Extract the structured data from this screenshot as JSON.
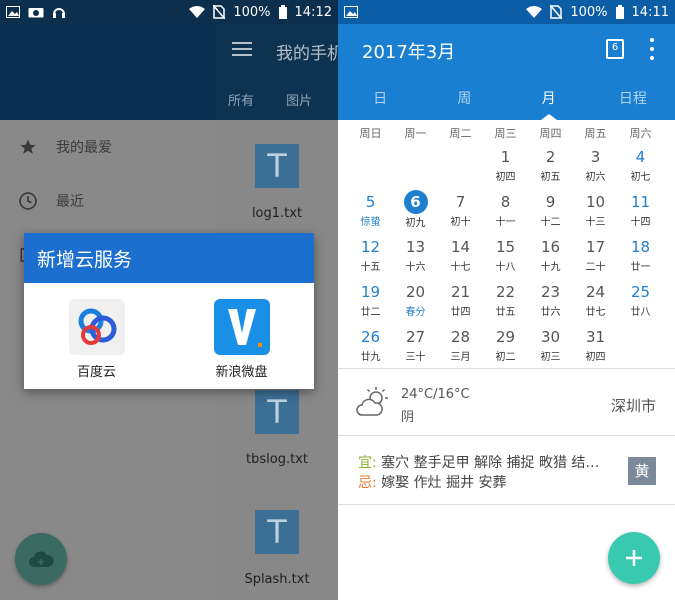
{
  "left": {
    "status": {
      "battery": "100%",
      "time": "14:12"
    },
    "drawer": {
      "items": [
        {
          "label": "我的最爱",
          "icon": "star-icon"
        },
        {
          "label": "最近",
          "icon": "clock-icon"
        }
      ]
    },
    "file_pane": {
      "title": "我的手机",
      "tabs": [
        "所有",
        "图片"
      ],
      "files": [
        {
          "name": "log1.txt",
          "icon_letter": "T"
        },
        {
          "name": "tbslog.txt",
          "icon_letter": "T"
        },
        {
          "name": "Splash.txt",
          "icon_letter": "T"
        }
      ]
    },
    "dialog": {
      "title": "新增云服务",
      "services": [
        {
          "label": "百度云",
          "icon": "baidu-cloud-icon"
        },
        {
          "label": "新浪微盘",
          "icon": "sina-vdisk-icon"
        }
      ]
    },
    "fab_icon": "cloud-add-icon"
  },
  "right": {
    "status": {
      "battery": "100%",
      "time": "14:11"
    },
    "header": {
      "title": "2017年3月",
      "today_badge": "6",
      "views": [
        "日",
        "周",
        "月",
        "日程"
      ],
      "active_view": "月"
    },
    "weekdays": [
      "周日",
      "周一",
      "周二",
      "周三",
      "周四",
      "周五",
      "周六"
    ],
    "weeks": [
      [
        null,
        null,
        null,
        {
          "d": "1",
          "l": "初四"
        },
        {
          "d": "2",
          "l": "初五"
        },
        {
          "d": "3",
          "l": "初六"
        },
        {
          "d": "4",
          "l": "初七"
        }
      ],
      [
        {
          "d": "5",
          "l": "惊蛰",
          "term": true
        },
        {
          "d": "6",
          "l": "初九",
          "today": true
        },
        {
          "d": "7",
          "l": "初十"
        },
        {
          "d": "8",
          "l": "十一"
        },
        {
          "d": "9",
          "l": "十二"
        },
        {
          "d": "10",
          "l": "十三"
        },
        {
          "d": "11",
          "l": "十四"
        }
      ],
      [
        {
          "d": "12",
          "l": "十五"
        },
        {
          "d": "13",
          "l": "十六"
        },
        {
          "d": "14",
          "l": "十七"
        },
        {
          "d": "15",
          "l": "十八"
        },
        {
          "d": "16",
          "l": "十九"
        },
        {
          "d": "17",
          "l": "二十"
        },
        {
          "d": "18",
          "l": "廿一"
        }
      ],
      [
        {
          "d": "19",
          "l": "廿二"
        },
        {
          "d": "20",
          "l": "春分",
          "term": true
        },
        {
          "d": "21",
          "l": "廿四"
        },
        {
          "d": "22",
          "l": "廿五"
        },
        {
          "d": "23",
          "l": "廿六"
        },
        {
          "d": "24",
          "l": "廿七"
        },
        {
          "d": "25",
          "l": "廿八"
        }
      ],
      [
        {
          "d": "26",
          "l": "廿九"
        },
        {
          "d": "27",
          "l": "三十"
        },
        {
          "d": "28",
          "l": "三月"
        },
        {
          "d": "29",
          "l": "初二"
        },
        {
          "d": "30",
          "l": "初三"
        },
        {
          "d": "31",
          "l": "初四"
        },
        null
      ]
    ],
    "weather": {
      "icon": "partly-cloudy-icon",
      "temp": "24°C/16°C",
      "condition": "阴",
      "city": "深圳市"
    },
    "almanac": {
      "yi_label": "宜:",
      "yi_text": "塞穴 整手足甲 解除 捕捉 畋猎 结…",
      "ji_label": "忌:",
      "ji_text": "嫁娶 作灶 掘井 安葬",
      "badge": "黄"
    },
    "fab_icon": "plus-icon"
  },
  "colors": {
    "calendar_blue": "#1a7fd1",
    "dialog_blue": "#1c6fcf",
    "fab_teal": "#38c9b0"
  }
}
